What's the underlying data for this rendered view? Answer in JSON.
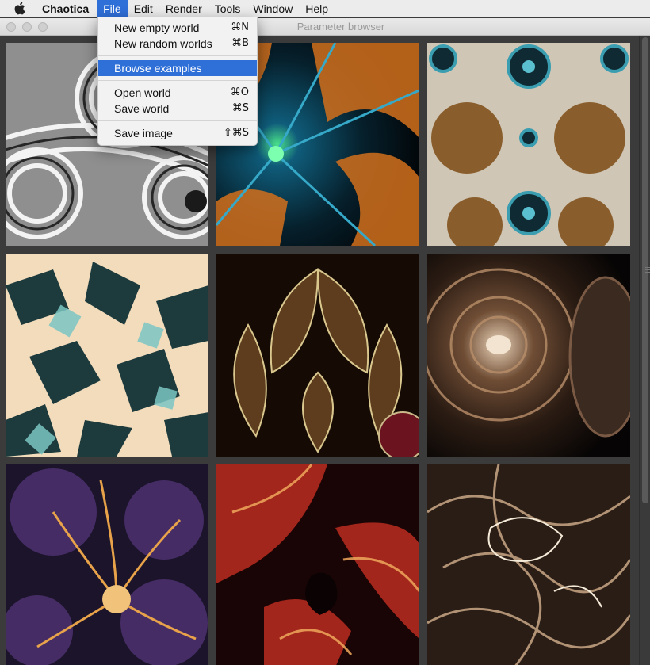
{
  "menubar": {
    "app_name": "Chaotica",
    "items": [
      "File",
      "Edit",
      "Render",
      "Tools",
      "Window",
      "Help"
    ],
    "active": "File"
  },
  "window": {
    "title": "Parameter browser"
  },
  "file_menu": {
    "groups": [
      [
        {
          "label": "New empty world",
          "shortcut": "⌘N"
        },
        {
          "label": "New random worlds",
          "shortcut": "⌘B"
        }
      ],
      [
        {
          "label": "Browse examples",
          "shortcut": "",
          "highlighted": true
        }
      ],
      [
        {
          "label": "Open world",
          "shortcut": "⌘O"
        },
        {
          "label": "Save world",
          "shortcut": "⌘S"
        }
      ],
      [
        {
          "label": "Save image",
          "shortcut": "⇧⌘S"
        }
      ]
    ]
  },
  "gallery": {
    "thumbnails": [
      {
        "name": "thumbnail-grey-spirals",
        "palette": [
          "#f2f2f2",
          "#9a9a9a",
          "#1c1c1c"
        ]
      },
      {
        "name": "thumbnail-blue-orange-star",
        "palette": [
          "#36d67a",
          "#0e4a66",
          "#d9741c"
        ]
      },
      {
        "name": "thumbnail-gold-teal-orbs",
        "palette": [
          "#cfc6b6",
          "#9b6e35",
          "#1f6a7c"
        ]
      },
      {
        "name": "thumbnail-teal-cream-tiles",
        "palette": [
          "#f4e0c3",
          "#2a5f5c",
          "#0e1e24"
        ]
      },
      {
        "name": "thumbnail-olive-petals",
        "palette": [
          "#e7d9a6",
          "#6b4a25",
          "#2a1408"
        ]
      },
      {
        "name": "thumbnail-bronze-tunnel",
        "palette": [
          "#ead6c0",
          "#6b4b34",
          "#0c0907"
        ]
      },
      {
        "name": "thumbnail-purple-gold-flower",
        "palette": [
          "#f0c67a",
          "#4b3070",
          "#141020"
        ]
      },
      {
        "name": "thumbnail-red-swirl",
        "palette": [
          "#f2b46b",
          "#a3251a",
          "#180406"
        ]
      },
      {
        "name": "thumbnail-sepia-smoke",
        "palette": [
          "#f4ead8",
          "#8d6a4d",
          "#1b130e"
        ]
      }
    ]
  }
}
